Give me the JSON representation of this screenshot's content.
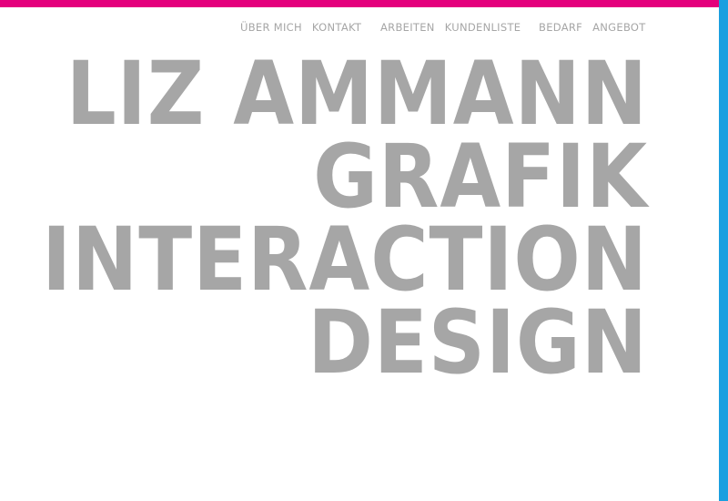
{
  "colors": {
    "top_bar": "#e4007c",
    "side_bar": "#1a9fe0",
    "text": "#a6a6a6"
  },
  "nav": {
    "groups": [
      {
        "items": [
          "ÜBER MICH",
          "KONTAKT"
        ]
      },
      {
        "items": [
          "ARBEITEN",
          "KUNDENLISTE"
        ]
      },
      {
        "items": [
          "BEDARF",
          "ANGEBOT"
        ]
      }
    ]
  },
  "hero": {
    "lines": [
      "LIZ AMMANN",
      "GRAFIK",
      "INTERACTION",
      "DESIGN"
    ]
  }
}
